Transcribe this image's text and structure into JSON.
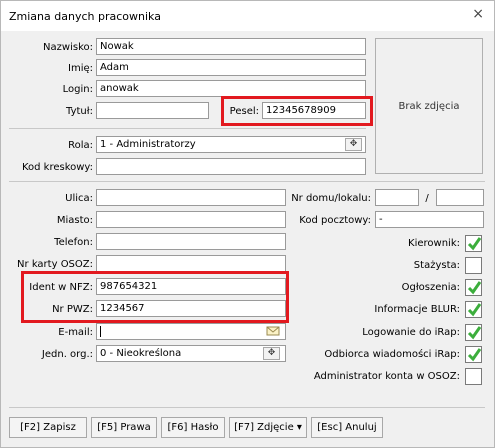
{
  "window": {
    "title": "Zmiana danych pracownika",
    "close_glyph": "×"
  },
  "form": {
    "nazwisko": {
      "label": "Nazwisko:",
      "value": "Nowak"
    },
    "imie": {
      "label": "Imię:",
      "value": "Adam"
    },
    "login": {
      "label": "Login:",
      "value": "anowak"
    },
    "tytul": {
      "label": "Tytuł:",
      "value": ""
    },
    "pesel": {
      "label": "Pesel:",
      "value": "12345678909"
    },
    "photo": {
      "label": "Brak zdjęcia"
    },
    "rola": {
      "label": "Rola:",
      "value": "1 - Administratorzy"
    },
    "kod_kreskowy": {
      "label": "Kod kreskowy:",
      "value": ""
    },
    "ulica": {
      "label": "Ulica:",
      "value": ""
    },
    "miasto": {
      "label": "Miasto:",
      "value": ""
    },
    "telefon": {
      "label": "Telefon:",
      "value": ""
    },
    "nr_karty": {
      "label": "Nr karty OSOZ:",
      "value": ""
    },
    "ident_nfz": {
      "label": "Ident w NFZ:",
      "value": "987654321"
    },
    "nr_pwz": {
      "label": "Nr PWZ:",
      "value": "1234567"
    },
    "email": {
      "label": "E-mail:",
      "value": ""
    },
    "jedn_org": {
      "label": "Jedn. org.:",
      "value": "0 - Nieokreślona"
    },
    "nr_domu": {
      "label": "Nr domu/lokalu:",
      "value": "",
      "separator": "/",
      "value2": ""
    },
    "kod_pocztowy": {
      "label": "Kod pocztowy:",
      "value": "-"
    }
  },
  "checkboxes": [
    {
      "label": "Kierownik:",
      "checked": true
    },
    {
      "label": "Stażysta:",
      "checked": false
    },
    {
      "label": "Ogłoszenia:",
      "checked": true
    },
    {
      "label": "Informacje BLUR:",
      "checked": true
    },
    {
      "label": "Logowanie do iRap:",
      "checked": true
    },
    {
      "label": "Odbiorca wiadomości iRap:",
      "checked": true
    },
    {
      "label": "Administrator konta w OSOZ:",
      "checked": false
    }
  ],
  "buttons": {
    "zapisz": "[F2] Zapisz",
    "prawa": "[F5] Prawa",
    "haslo": "[F6] Hasło",
    "zdjecie": "[F7] Zdjęcie ▾",
    "anuluj": "[Esc] Anuluj"
  },
  "colors": {
    "highlight": "#e2191f",
    "check": "#3cae3c"
  }
}
